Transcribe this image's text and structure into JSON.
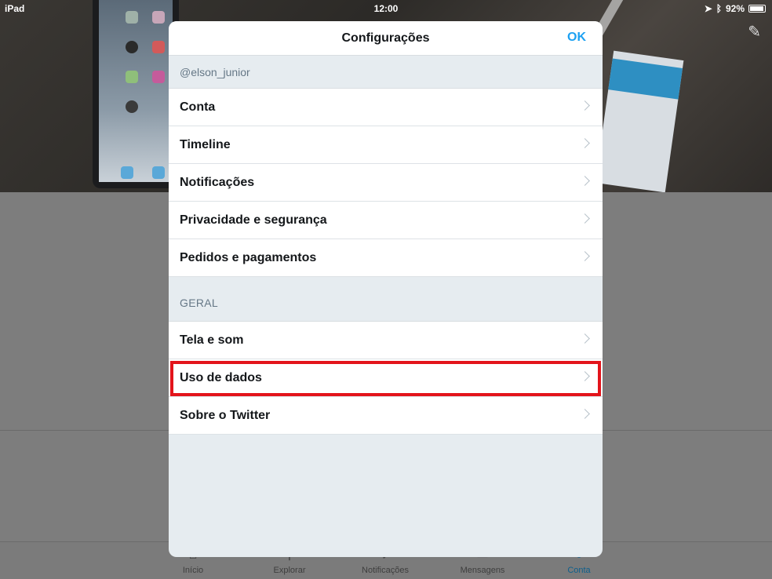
{
  "status_bar": {
    "device": "iPad",
    "time": "12:00",
    "battery": "92%"
  },
  "modal": {
    "title": "Configurações",
    "ok_label": "OK",
    "account_handle": "@elson_junior",
    "account_items": [
      {
        "label": "Conta"
      },
      {
        "label": "Timeline"
      },
      {
        "label": "Notificações"
      },
      {
        "label": "Privacidade e segurança"
      },
      {
        "label": "Pedidos e pagamentos"
      }
    ],
    "general_header": "GERAL",
    "general_items": [
      {
        "label": "Tela e som"
      },
      {
        "label": "Uso de dados"
      },
      {
        "label": "Sobre o Twitter"
      }
    ],
    "highlight_color": "#e3141b",
    "accent_color": "#1da1f2"
  },
  "tab_bar": {
    "items": [
      {
        "label": "Início",
        "icon": "home-icon"
      },
      {
        "label": "Explorar",
        "icon": "search-icon"
      },
      {
        "label": "Notificações",
        "icon": "bell-icon"
      },
      {
        "label": "Mensagens",
        "icon": "message-icon"
      },
      {
        "label": "Conta",
        "icon": "person-icon"
      }
    ],
    "active": "Conta"
  }
}
